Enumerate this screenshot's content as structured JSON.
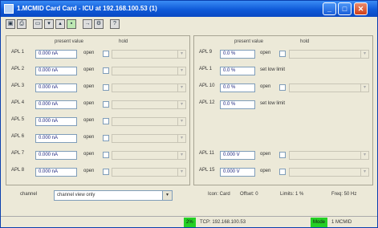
{
  "window": {
    "title": "1.MCMID Card Card - ICU at 192.168.100.53 (1)",
    "controls": {
      "minimize": "_",
      "maximize": "□",
      "close": "✕"
    }
  },
  "toolbar": {
    "icons": [
      "save-icon",
      "print-icon",
      "card-icon",
      "card-down-icon",
      "card-up-icon",
      "card-green-icon",
      "arrow-icon",
      "settings-icon",
      "help-icon"
    ]
  },
  "left_panel": {
    "header_value": "present value",
    "header_hold": "hold",
    "rows": [
      {
        "label": "APL 1",
        "value": "0.000 nA",
        "status": "open"
      },
      {
        "label": "APL 2",
        "value": "0.000 nA",
        "status": "open"
      },
      {
        "label": "APL 3",
        "value": "0.000 nA",
        "status": "open"
      },
      {
        "label": "APL 4",
        "value": "0.000 nA",
        "status": "open"
      },
      {
        "label": "APL 5",
        "value": "0.000 nA",
        "status": "open"
      },
      {
        "label": "APL 6",
        "value": "0.000 nA",
        "status": "open"
      },
      {
        "label": "APL 7",
        "value": "0.000 nA",
        "status": "open"
      },
      {
        "label": "APL 8",
        "value": "0.000 nA",
        "status": "open"
      }
    ]
  },
  "right_panel": {
    "header_value": "present value",
    "header_hold": "hold",
    "rows": [
      {
        "label": "APL 9",
        "value": "0.0 %",
        "status": "open"
      },
      {
        "label": "APL 1",
        "value": "0.0 %",
        "status": "set low limit"
      },
      {
        "label": "APL 10",
        "value": "0.0 %",
        "status": "open"
      },
      {
        "label": "APL 12",
        "value": "0.0 %",
        "status": "set low limit"
      },
      {
        "label": "APL 11",
        "value": "0.000 V",
        "status": "open"
      },
      {
        "label": "APL 15",
        "value": "0.000 V",
        "status": "open"
      }
    ]
  },
  "bottom": {
    "label": "channel",
    "combo_value": "channel view only",
    "info_1": "Icon: Card",
    "info_2": "Offset: 0",
    "info_3": "Limits: 1 %",
    "info_4": "Freq: 50 Hz"
  },
  "statusbar": {
    "green_1": "2%",
    "address": "TCP: 192.168.100.53",
    "green_2": "Mode",
    "right_text": "1 MCMID"
  }
}
